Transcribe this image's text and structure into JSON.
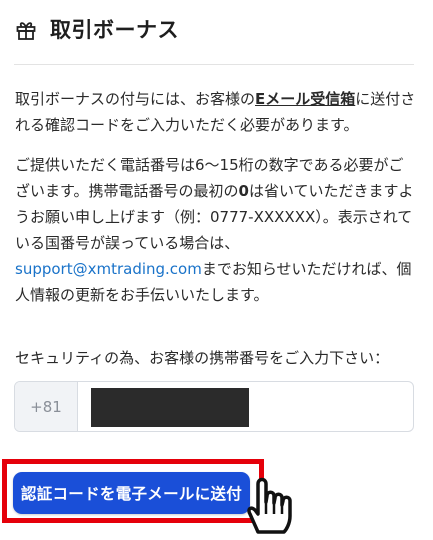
{
  "header": {
    "icon": "gift-icon",
    "title": "取引ボーナス"
  },
  "intro": {
    "part1": "取引ボーナスの付与には、お客様の",
    "emphasis": "Eメール受信箱",
    "part2": "に送付される確認コードをご入力いただく必要があります。"
  },
  "phone_note": {
    "part1": "ご提供いただく電話番号は6～15桁の数字である必要がございます。携帯電話番号の最初の",
    "bold_zero": "0",
    "part2": "は省いていただきますようお願い申し上げます（例：0777-XXXXXX）。表示されている国番号が誤っている場合は、",
    "email": "support@xmtrading.com",
    "part3": "までお知らせいただければ、個人情報の更新をお手伝いいたします。"
  },
  "phone_field": {
    "label": "セキュリティの為、お客様の携帯番号をご入力下さい：",
    "country_code": "+81",
    "value_redacted": true
  },
  "send_button": {
    "label": "認証コードを電子メールに送付"
  },
  "colors": {
    "button": "#1a4fd8",
    "highlight": "#e5000a",
    "link": "#1a73c9"
  },
  "cursor": "pointer-hand-icon"
}
